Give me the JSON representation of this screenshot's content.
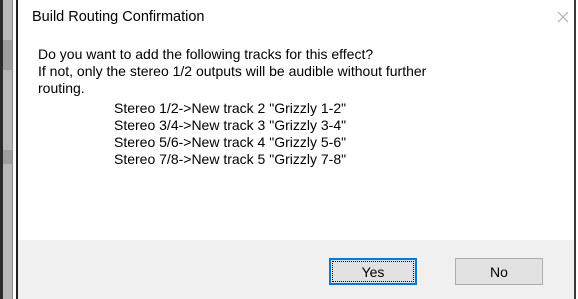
{
  "window": {
    "title": "Build Routing Confirmation",
    "close_icon": "close-icon"
  },
  "message": {
    "lines": [
      "Do you want to add the following tracks for this effect?",
      "If not, only the stereo 1/2 outputs will be audible without further",
      "routing."
    ]
  },
  "routes": [
    "Stereo 1/2->New track 2 \"Grizzly 1-2\"",
    "Stereo 3/4->New track 3 \"Grizzly 3-4\"",
    "Stereo 5/6->New track 4 \"Grizzly 5-6\"",
    "Stereo 7/8->New track 5 \"Grizzly 7-8\""
  ],
  "buttons": {
    "yes_label": "Yes",
    "no_label": "No"
  },
  "colors": {
    "default_button_border": "#0078d7",
    "footer_background": "#f0f0f0"
  }
}
